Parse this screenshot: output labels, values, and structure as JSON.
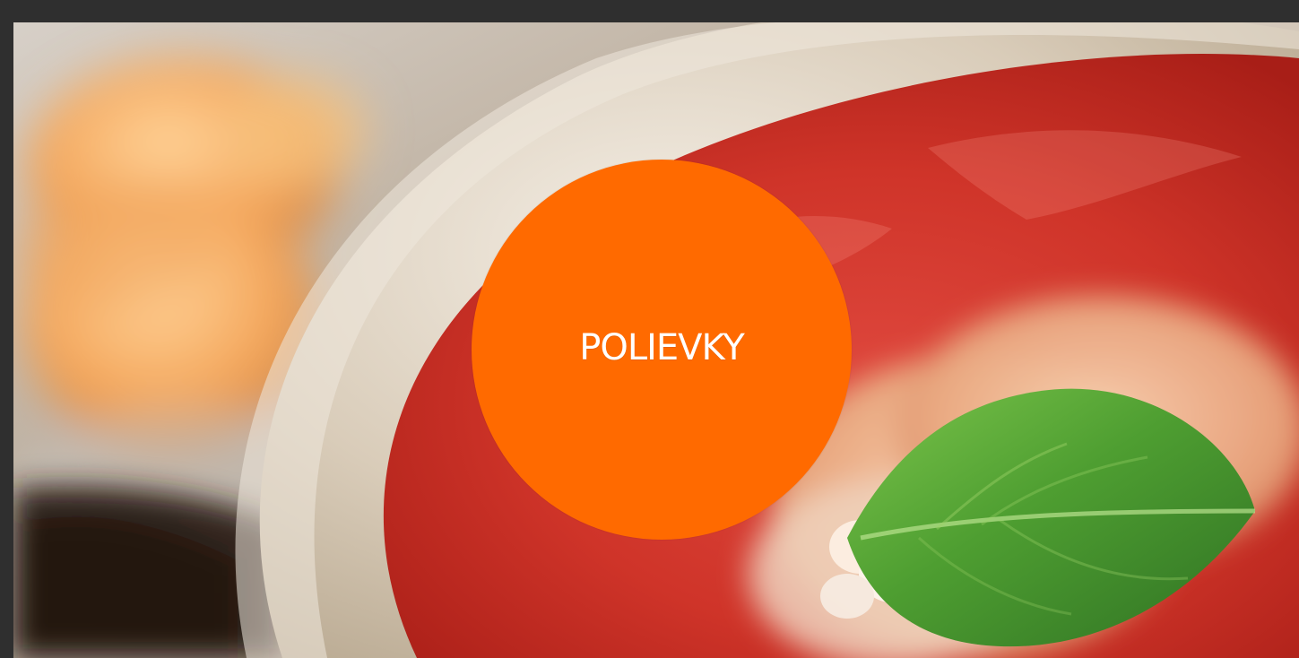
{
  "hero": {
    "category_label": "POLIEVKY",
    "accent_color": "#ff6a00"
  }
}
